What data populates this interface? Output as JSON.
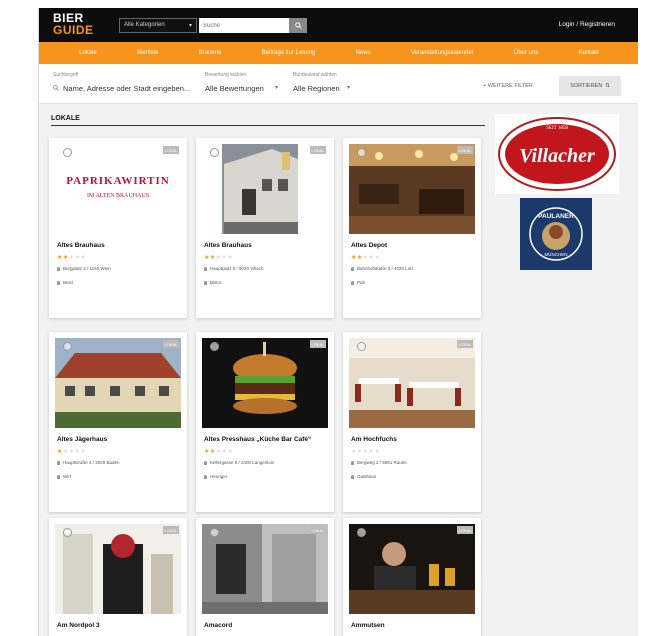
{
  "header": {
    "logo_top": "BIER",
    "logo_bottom": "GUIDE",
    "category_select": "Alle Kategorien",
    "search_placeholder": "Suche",
    "login": "Login / Registrieren"
  },
  "nav": {
    "items": [
      "Lokale",
      "Bierliste",
      "Brauerei",
      "Beiträge zur Lesung",
      "News",
      "Veranstaltungskalender",
      "Über uns",
      "Kontakt"
    ]
  },
  "filters": {
    "search": {
      "label": "Suchbegriff",
      "value": "Name, Adresse oder Stadt eingeben..."
    },
    "rating": {
      "label": "Bewertung wählen",
      "value": "Alle Bewertungen"
    },
    "region": {
      "label": "Bundesland wählen",
      "value": "Alle Regionen"
    },
    "more": "WEITERE FILTER",
    "sort": "SORTIEREN"
  },
  "section": {
    "title": "LOKALE"
  },
  "cards": [
    {
      "name": "Altes Brauhaus",
      "stars": 2,
      "address": "Burgplatz 3 / 1150 Wien",
      "type": "Beisl",
      "badge": "LOKAL"
    },
    {
      "name": "Altes Brauhaus",
      "stars": 2,
      "address": "Hauptplatz 5 / 9020 Villach",
      "type": "Bistro",
      "badge": "LOKAL"
    },
    {
      "name": "Altes Depot",
      "stars": 2,
      "address": "Bahnhofstraße 3 / 4020 Linz",
      "type": "Pub",
      "badge": "LOKAL"
    },
    {
      "name": "Altes Jägerhaus",
      "stars": 1,
      "address": "Hauptstraße 4 / 2020 Baden",
      "type": "Wirt",
      "badge": "LOKAL"
    },
    {
      "name": "Altes Presshaus „Küche Bar Café“",
      "stars": 2,
      "address": "Kellergasse 8 / 3400 Langenlois",
      "type": "Heuriger",
      "badge": "LOKAL"
    },
    {
      "name": "Am Hochfuchs",
      "stars": 0,
      "address": "Bergweg 2 / 5661 Rauris",
      "type": "Gasthaus",
      "badge": "LOKAL"
    },
    {
      "name": "Am Nordpol 3",
      "stars": 0,
      "address": "",
      "type": "",
      "badge": "LOKAL"
    },
    {
      "name": "Amacord",
      "stars": 0,
      "address": "",
      "type": "",
      "badge": "LOKAL"
    },
    {
      "name": "Ammutsen",
      "stars": 0,
      "address": "",
      "type": "",
      "badge": "LOKAL"
    }
  ],
  "ads": {
    "villacher": {
      "ring_top": "SEIT 1858",
      "brand": "Villacher"
    },
    "paulaner": {
      "brand": "PAULANER",
      "sub": "MÜNCHEN"
    }
  }
}
